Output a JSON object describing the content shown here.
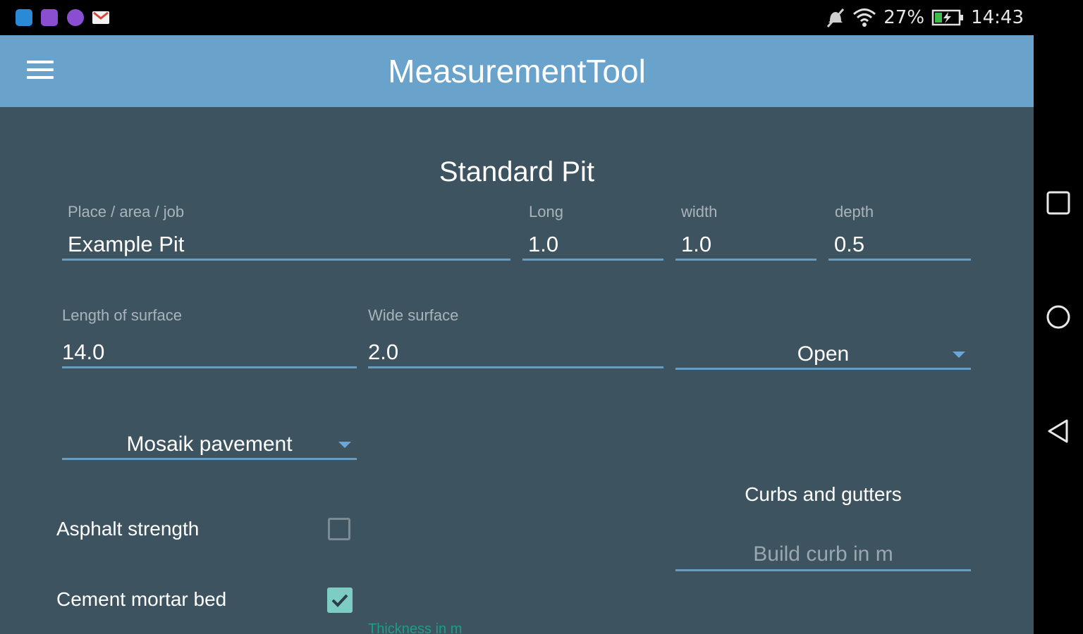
{
  "status_bar": {
    "battery": "27%",
    "time": "14:43",
    "notification_icons": [
      "app-icon-blue",
      "app-icon-purple-1",
      "app-icon-purple-2",
      "gmail-icon"
    ],
    "status_icons": [
      "mute-icon",
      "wifi-icon",
      "battery-charging-icon"
    ]
  },
  "app_bar": {
    "title": "MeasurementTool",
    "menu_icon": "hamburger-menu-icon"
  },
  "form": {
    "section_title": "Standard Pit",
    "place": {
      "label": "Place / area / job",
      "value": "Example Pit"
    },
    "long": {
      "label": "Long",
      "value": "1.0"
    },
    "width": {
      "label": "width",
      "value": "1.0"
    },
    "depth": {
      "label": "depth",
      "value": "0.5"
    },
    "length_surface": {
      "label": "Length of surface",
      "value": "14.0"
    },
    "wide_surface": {
      "label": "Wide surface",
      "value": "2.0"
    },
    "open_select": {
      "value": "Open"
    },
    "pavement_select": {
      "value": "Mosaik pavement"
    },
    "asphalt": {
      "label": "Asphalt strength",
      "checked": false
    },
    "cement": {
      "label": "Cement mortar bed",
      "checked": true
    },
    "thickness_hint": "Thickness in m",
    "curbs": {
      "title": "Curbs and gutters",
      "placeholder": "Build curb in m"
    }
  },
  "colors": {
    "app_bar": "#69a3cb",
    "content_bg": "#3d5360",
    "accent": "#6a9cc0",
    "check_accent": "#7ecdc4"
  },
  "nav_bar": {
    "buttons": [
      "recent-apps-icon",
      "home-icon",
      "back-icon"
    ]
  }
}
